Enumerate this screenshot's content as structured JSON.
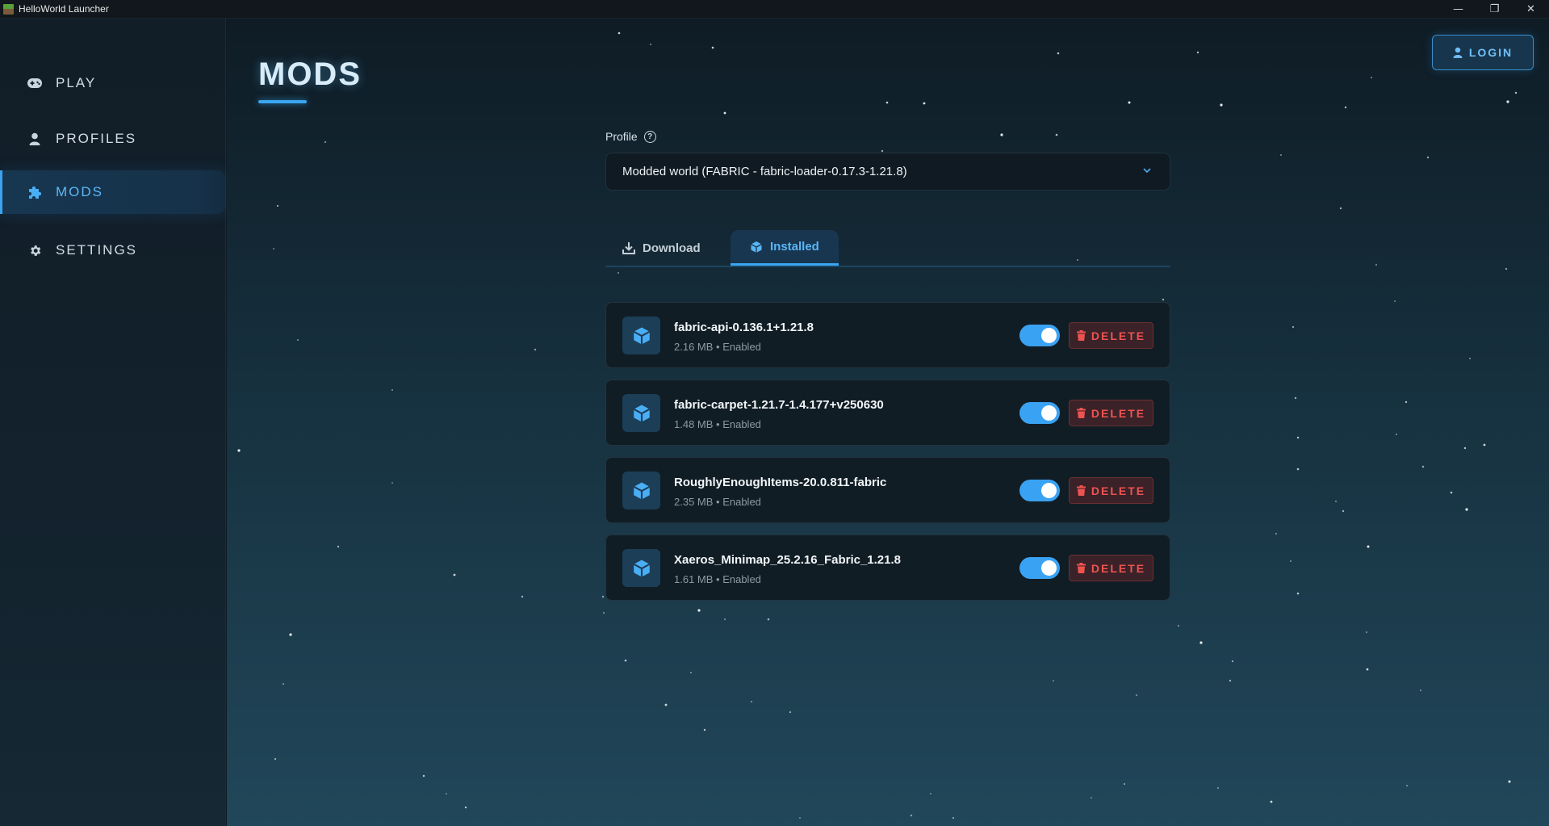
{
  "window": {
    "title": "HelloWorld Launcher",
    "controls": {
      "minimize": "—",
      "restore": "❐",
      "close": "✕"
    }
  },
  "sidebar": {
    "items": [
      {
        "label": "PLAY",
        "icon": "gamepad-icon",
        "active": false
      },
      {
        "label": "PROFILES",
        "icon": "user-icon",
        "active": false
      },
      {
        "label": "MODS",
        "icon": "puzzle-icon",
        "active": true
      },
      {
        "label": "SETTINGS",
        "icon": "gear-icon",
        "active": false
      }
    ]
  },
  "header": {
    "title": "MODS",
    "login_label": "LOGIN"
  },
  "profile": {
    "label": "Profile",
    "help": "?",
    "selected": "Modded world (FABRIC - fabric-loader-0.17.3-1.21.8)"
  },
  "tabs": [
    {
      "label": "Download",
      "icon": "download-icon",
      "active": false
    },
    {
      "label": "Installed",
      "icon": "cube-icon",
      "active": true
    }
  ],
  "mods": [
    {
      "name": "fabric-api-0.136.1+1.21.8",
      "meta": "2.16 MB • Enabled",
      "enabled": true,
      "delete_label": "DELETE"
    },
    {
      "name": "fabric-carpet-1.21.7-1.4.177+v250630",
      "meta": "1.48 MB • Enabled",
      "enabled": true,
      "delete_label": "DELETE"
    },
    {
      "name": "RoughlyEnoughItems-20.0.811-fabric",
      "meta": "2.35 MB • Enabled",
      "enabled": true,
      "delete_label": "DELETE"
    },
    {
      "name": "Xaeros_Minimap_25.2.16_Fabric_1.21.8",
      "meta": "1.61 MB • Enabled",
      "enabled": true,
      "delete_label": "DELETE"
    }
  ],
  "colors": {
    "accent": "#3aa6f0",
    "danger": "#ef5350",
    "sidebar_bg": "#111d27"
  }
}
